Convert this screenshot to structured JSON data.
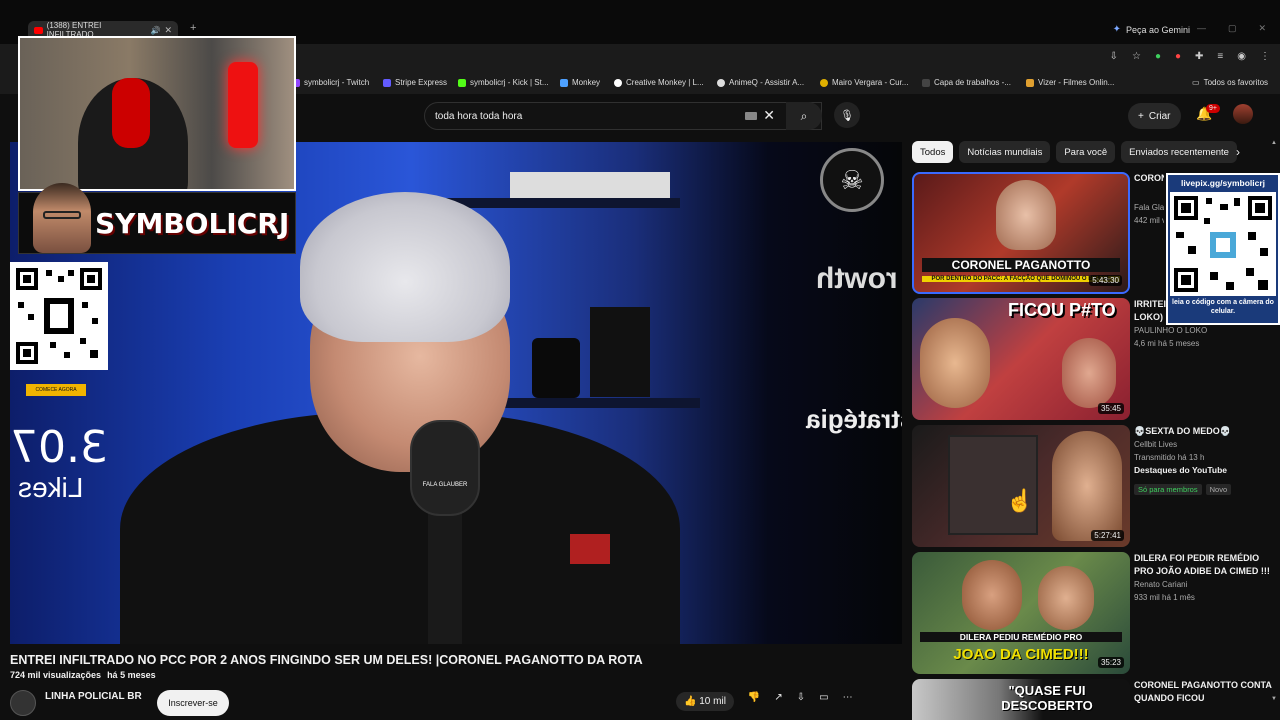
{
  "browser": {
    "tab_title": "(1388) ENTREI INFILTRADO",
    "gemini_label": "Peça ao Gemini",
    "bookmarks": [
      {
        "label": "symbolicrj - Twitch",
        "color": "#9146ff"
      },
      {
        "label": "Stripe Express",
        "color": "#635bff"
      },
      {
        "label": "symbolicrj - Kick | St...",
        "color": "#53fc18"
      },
      {
        "label": "Monkey",
        "color": "#4ea1ff"
      },
      {
        "label": "Creative Monkey | L...",
        "color": "#ffffff"
      },
      {
        "label": "AnimeQ - Assistir A...",
        "color": "#dddddd"
      },
      {
        "label": "Mairo Vergara - Cur...",
        "color": "#e0b000"
      },
      {
        "label": "Capa de trabalhos -...",
        "color": "#444444"
      },
      {
        "label": "Vizer - Filmes Onlin...",
        "color": "#e0a030"
      },
      {
        "label": "Todos os favoritos",
        "color": "#888888"
      }
    ]
  },
  "youtube": {
    "search_value": "toda hora toda hora",
    "create_label": "Criar",
    "notif_badge": "9+"
  },
  "overlay": {
    "streamer_name": "SYMBOLICRJ",
    "qr_button": "COMECE AGORA",
    "qr_right_top": "livepix.gg/symbolicrj",
    "qr_right_bottom": "leia o código com a câmera do celular."
  },
  "video": {
    "title": "ENTREI INFILTRADO NO PCC POR 2 ANOS FINGINDO SER UM DELES! |CORONEL PAGANOTTO DA ROTA",
    "views": "724 mil visualizações",
    "age": "há 5 meses",
    "channel": "LINHA POLICIAL BR",
    "subscribe_label": "Inscrever-se",
    "likes_label": "10 mil",
    "backdrop_likes": "3.07",
    "backdrop_likes_word": "Likes",
    "wall_text_1": "rowth",
    "wall_text_2": "stratégia",
    "mic_label": "FALA GLAUBER"
  },
  "chips": [
    "Todos",
    "Notícias mundiais",
    "Para você",
    "Enviados recentemente"
  ],
  "recommendations": [
    {
      "title": "CORONEL PAGANOTTO: POR DENTRO DO PCC: A F4CÇÃO...",
      "channel": "Fala Glauber",
      "meta": "442 mil visualizações",
      "duration": "5:43:30",
      "caption": "CORONEL PAGANOTTO",
      "subcaption": "POR DENTRO DO PACC: A FACÇÃO QUE DOMINOU O BRASIL"
    },
    {
      "title": "IRRITEI ... ao VIVO (Paulinho o LOKO)",
      "channel": "PAULINHO O LOKO",
      "meta": "4,6 mi  há 5 meses",
      "duration": "35:45",
      "caption": "FICOU P#TO"
    },
    {
      "title": "💀SEXTA DO MEDO💀",
      "channel": "Cellbit Lives",
      "meta": "Transmitido há 13 h",
      "highlight": "Destaques do YouTube",
      "members_tag": "Só para membros",
      "new_tag": "Novo",
      "duration": "5:27:41"
    },
    {
      "title": "DILERA FOI PEDIR REMÉDIO PRO JOÃO ADIBE DA CIMED !!!",
      "channel": "Renato Cariani",
      "meta": "933 mil  há 1 mês",
      "duration": "35:23",
      "caption": "DILERA PEDIU REMÉDIO PRO",
      "subcaption": "JOAO DA CIMED!!!"
    },
    {
      "title": "CORONEL PAGANOTTO CONTA QUANDO FICOU",
      "caption": "\"QUASE FUI DESCOBERTO"
    }
  ],
  "icons": {
    "search": "search-icon",
    "mic": "mic-icon",
    "bell": "bell-icon",
    "close": "close-icon"
  }
}
